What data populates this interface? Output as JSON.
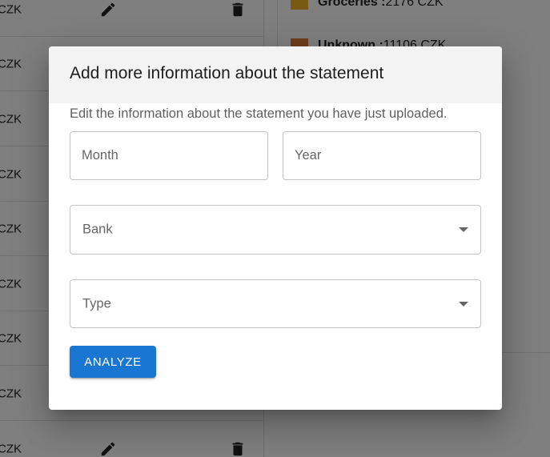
{
  "background": {
    "rows": [
      {
        "amount": "CZK"
      },
      {
        "amount": "CZK"
      },
      {
        "amount": "CZK"
      },
      {
        "amount": "CZK"
      },
      {
        "amount": "CZK"
      },
      {
        "amount": "CZK"
      },
      {
        "amount": "CZK"
      },
      {
        "amount": "CZK"
      },
      {
        "amount": "CZK"
      }
    ],
    "legend": [
      {
        "name": "Groceries :",
        "value": " 2176 CZK",
        "color": "#f0b429"
      },
      {
        "name": "Unknown :",
        "value": " 11106 CZK",
        "color": "#e07a3a"
      }
    ]
  },
  "dialog": {
    "title": "Add more information about the statement",
    "description": "Edit the information about the statement you have just uploaded.",
    "month": {
      "placeholder": "Month",
      "value": ""
    },
    "year": {
      "placeholder": "Year",
      "value": ""
    },
    "bank": {
      "label": "Bank"
    },
    "type": {
      "label": "Type"
    },
    "analyze_label": "ANALYZE"
  },
  "colors": {
    "primary": "#1976d2",
    "scrim": "rgba(0,0,0,0.5)"
  }
}
